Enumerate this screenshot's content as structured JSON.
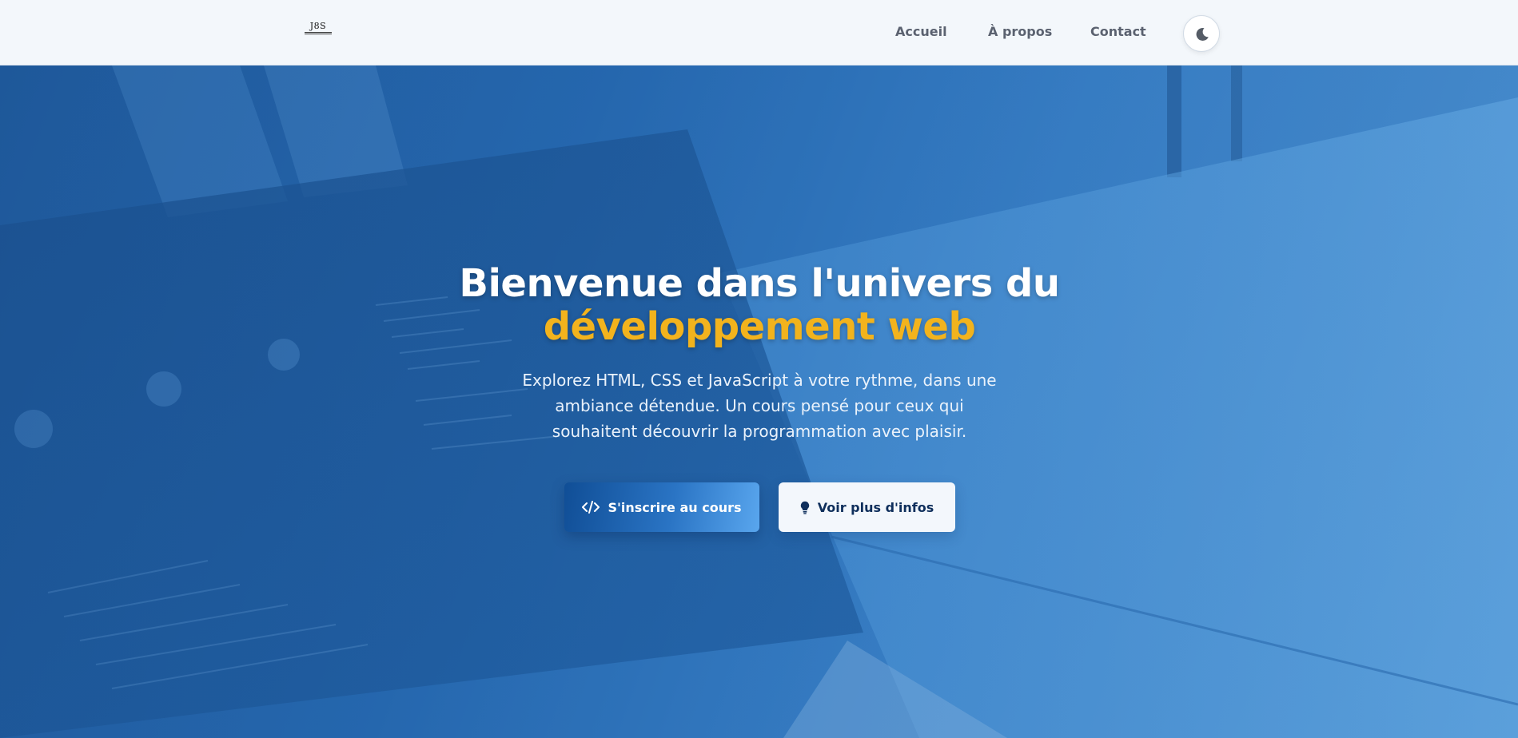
{
  "header": {
    "logo_text": "J8S",
    "nav": {
      "home": "Accueil",
      "about": "À propos",
      "contact": "Contact"
    },
    "theme_toggle_icon": "moon-icon"
  },
  "hero": {
    "title_line1": "Bienvenue dans l'univers du",
    "title_line2": "développement web",
    "subtitle": "Explorez HTML, CSS et JavaScript à votre rythme, dans une ambiance détendue. Un cours pensé pour ceux qui souhaitent découvrir la programmation avec plaisir.",
    "primary_button": {
      "label": "S'inscrire au cours",
      "icon": "code-icon"
    },
    "secondary_button": {
      "label": "Voir plus d'infos",
      "icon": "lightbulb-icon"
    }
  },
  "colors": {
    "accent_yellow": "#f2b31d",
    "hero_blue": "#2466ad",
    "header_bg": "#f3f7fb",
    "nav_text": "#5b6270"
  }
}
